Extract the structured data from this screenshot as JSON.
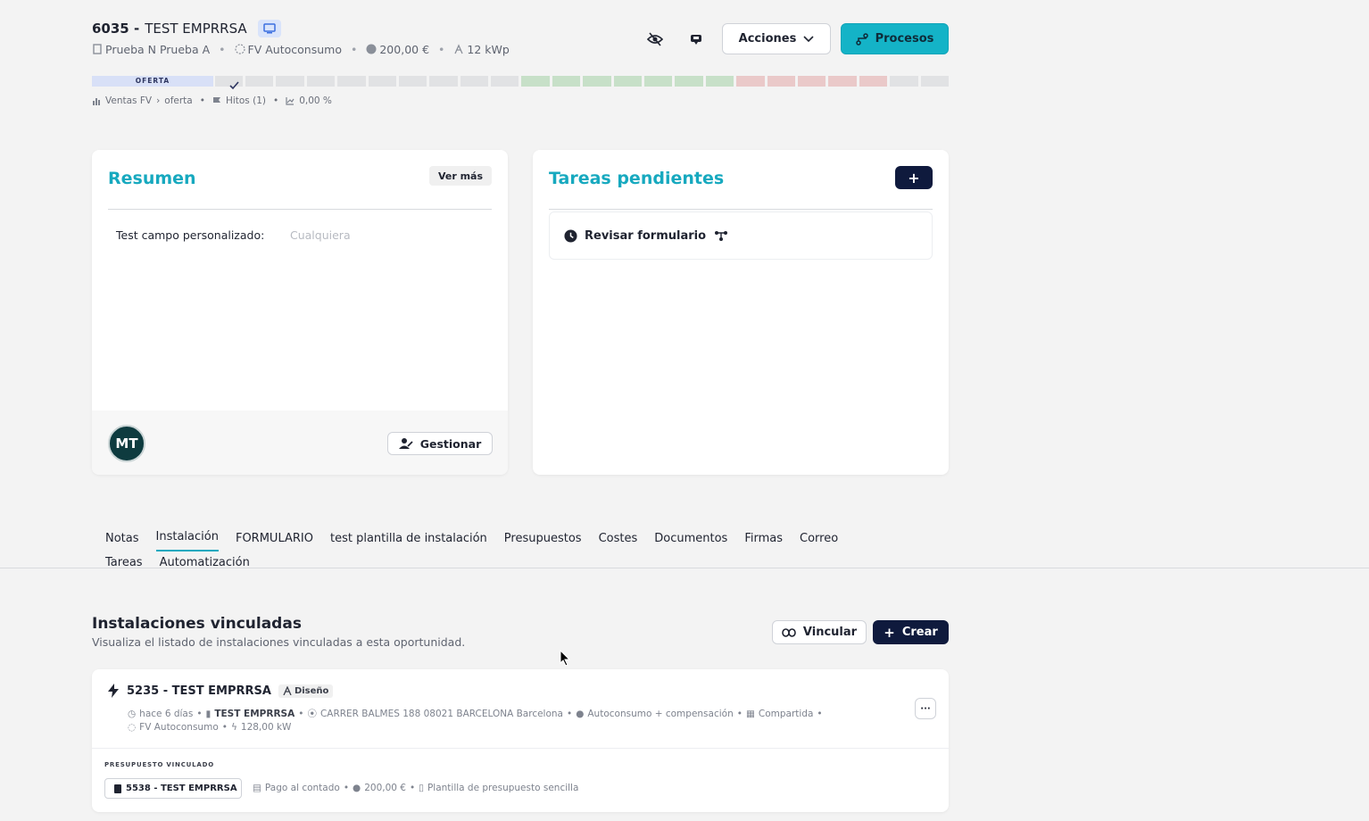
{
  "header": {
    "number": "6035 -",
    "name": "TEST EMPRRSA",
    "meta": {
      "contact": "Prueba N Prueba A",
      "type": "FV Autoconsumo",
      "amount": "200,00 €",
      "power": "12 kWp"
    },
    "actions_label": "Acciones",
    "processes_label": "Procesos"
  },
  "pipeline": {
    "stage_label": "OFERTA",
    "segment_colors": [
      "#e8ecf9",
      "#d8dbe0",
      "#e1e2e4",
      "#e1e2e4",
      "#e1e2e4",
      "#e1e2e4",
      "#e1e2e4",
      "#e1e2e4",
      "#e1e2e4",
      "#e1e2e4",
      "#e1e2e4",
      "#e1e2e4",
      "#e1e2e4",
      "#e1e2e4",
      "#c7e0c8",
      "#c7e0c8",
      "#c7e0c8",
      "#c7e0c8",
      "#c7e0c8",
      "#c7e0c8",
      "#c7e0c8",
      "#eac9c9",
      "#eac9c9",
      "#eac9c9",
      "#eac9c9",
      "#eac9c9",
      "#e1e2e4",
      "#e1e2e4"
    ],
    "breadcrumb_a": "Ventas FV",
    "breadcrumb_b": "oferta",
    "milestones": "Hitos (1)",
    "percent": "0,00 %"
  },
  "summary": {
    "title": "Resumen",
    "see_more": "Ver más",
    "field_label": "Test campo personalizado:",
    "field_value": "Cualquiera",
    "avatar_initials": "MT",
    "manage_label": "Gestionar"
  },
  "tasks": {
    "title": "Tareas pendientes",
    "add_label": "+",
    "item_label": "Revisar formulario"
  },
  "tabs": [
    "Notas",
    "Instalación",
    "FORMULARIO",
    "test plantilla de instalación",
    "Presupuestos",
    "Costes",
    "Documentos",
    "Firmas",
    "Correo",
    "Tareas",
    "Automatización"
  ],
  "installations": {
    "title": "Instalaciones vinculadas",
    "subtitle": "Visualiza el listado de instalaciones vinculadas a esta oportunidad.",
    "link_label": "Vincular",
    "create_label": "Crear",
    "item": {
      "title": "5235 - TEST EMPRRSA",
      "status": "Diseño",
      "time": "hace 6 días",
      "company": "TEST EMPRRSA",
      "address": "CARRER BALMES 188 08021 BARCELONA Barcelona",
      "mode": "Autoconsumo + compensación",
      "shared": "Compartida",
      "type": "FV Autoconsumo",
      "power": "128,00 kW",
      "more": "···"
    },
    "budget": {
      "heading": "PRESUPUESTO VINCULADO",
      "chip": "5538 - TEST EMPRRSA",
      "payment": "Pago al contado",
      "amount": "200,00 €",
      "template": "Plantilla de presupuesto sencilla"
    }
  }
}
